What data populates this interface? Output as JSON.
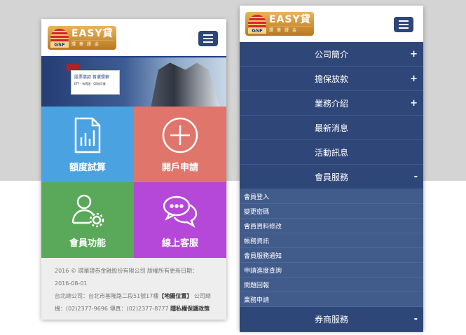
{
  "logo": {
    "brand": "EASY貸",
    "seal": "GSF",
    "sub": "環華證金"
  },
  "banner": {
    "headline": "股票借款 首選環華",
    "sub": "ETF・有價證・CB皆可貸"
  },
  "tiles": [
    {
      "label": "額度試算",
      "color": "#4aa3e0",
      "icon": "document-chart-icon"
    },
    {
      "label": "開戶申請",
      "color": "#e0756c",
      "icon": "plus-circle-icon"
    },
    {
      "label": "會員功能",
      "color": "#5aa85a",
      "icon": "user-gear-icon"
    },
    {
      "label": "線上客服",
      "color": "#b548d9",
      "icon": "chat-bubbles-icon"
    }
  ],
  "footer": {
    "line1": "2016 © 環華證券金融股份有限公司 版權所有更新日期：2016-08-01",
    "line2a": "台北總公司：台北市基隆路二段51號17樓",
    "map": "【地圖位置】",
    "line2b": "公司總機：(02)2377-9696 傳真：(02)2377-8777",
    "privacy": "隱私權保護政策"
  },
  "menu": [
    {
      "label": "公司簡介",
      "sign": "+"
    },
    {
      "label": "擔保放款",
      "sign": "+"
    },
    {
      "label": "業務介紹",
      "sign": "+"
    },
    {
      "label": "最新消息",
      "sign": ""
    },
    {
      "label": "活動訊息",
      "sign": ""
    },
    {
      "label": "會員服務",
      "sign": "-"
    }
  ],
  "submenu": [
    "會員登入",
    "變更密碼",
    "會員資料修改",
    "帳務資訊",
    "會員服務通知",
    "申請進度查詢",
    "問題回報",
    "業務申請"
  ],
  "menu_last": {
    "label": "券商服務",
    "sign": "-"
  }
}
